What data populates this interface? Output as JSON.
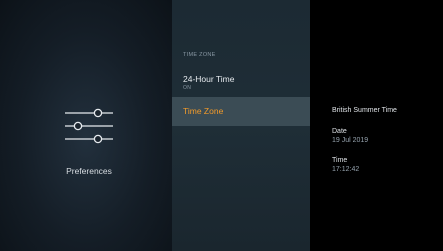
{
  "left_panel": {
    "category_label": "Preferences",
    "icon": "sliders-icon"
  },
  "middle_panel": {
    "section_header": "TIME ZONE",
    "items": [
      {
        "title": "24-Hour Time",
        "subtitle": "ON"
      },
      {
        "title": "Time Zone"
      }
    ]
  },
  "right_panel": {
    "zone_name": "British Summer Time",
    "date_label": "Date",
    "date_value": "19 Jul 2019",
    "time_label": "Time",
    "time_value": "17:12:42"
  },
  "colors": {
    "accent": "#f39b2a",
    "selected_bg": "#3b4c55",
    "middle_bg": "#1f2e37",
    "left_bg": "#141d26"
  }
}
